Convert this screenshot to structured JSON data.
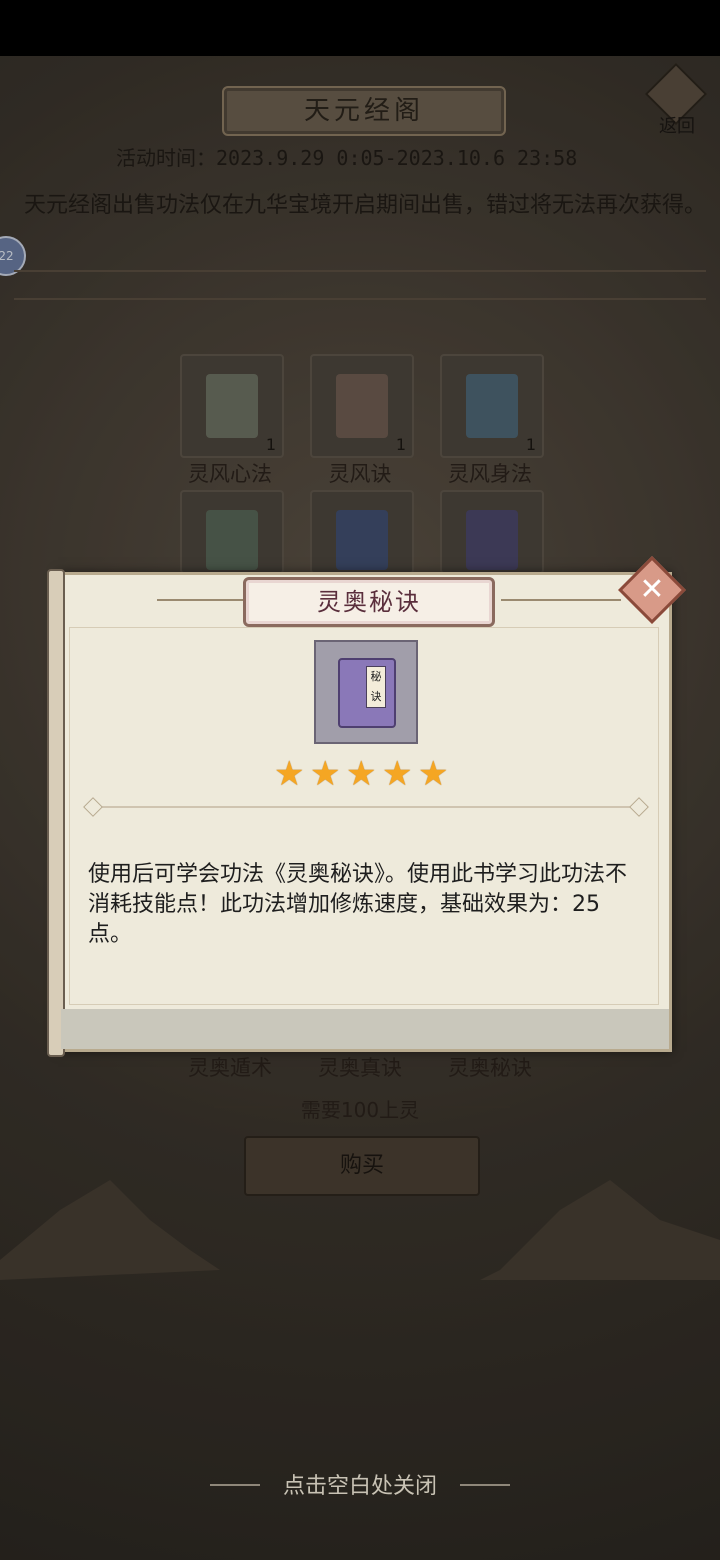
{
  "page": {
    "title": "天元经阁",
    "back_label": "返回",
    "activity_time": "活动时间：2023.9.29 0:05-2023.10.6 23:58",
    "notice": "天元经阁出售功法仅在九华宝境开启期间出售，错过将无法再次获得。",
    "side_chip": "22"
  },
  "items": [
    {
      "name": "灵风心法",
      "count": "1",
      "icon": "book-gray-icon",
      "color": "#6b6f61"
    },
    {
      "name": "灵风诀",
      "count": "1",
      "icon": "book-brown-icon",
      "color": "#6d5b50"
    },
    {
      "name": "灵风身法",
      "count": "1",
      "icon": "book-blue-icon",
      "color": "#4c6573"
    },
    {
      "icon": "book-green-icon",
      "color": "#566556"
    },
    {
      "icon": "book-navy-icon",
      "color": "#404e6e"
    },
    {
      "icon": "book-indigo-icon",
      "color": "#4a4668"
    }
  ],
  "bottom_items": [
    "灵奥遁术",
    "灵奥真诀",
    "灵奥秘诀"
  ],
  "need_text": "需要100上灵",
  "buy_label": "购买",
  "dialog": {
    "title": "灵奥秘诀",
    "icon": "book-purple-icon",
    "book_label": "秘诀",
    "stars": 5,
    "description": "使用后可学会功法《灵奥秘诀》。使用此书学习此功法不消耗技能点！此功法增加修炼速度，基础效果为：25点。"
  },
  "close_hint": "点击空白处关闭",
  "colors": {
    "accent_title": "#5a2e3c",
    "star": "#f5a623"
  }
}
